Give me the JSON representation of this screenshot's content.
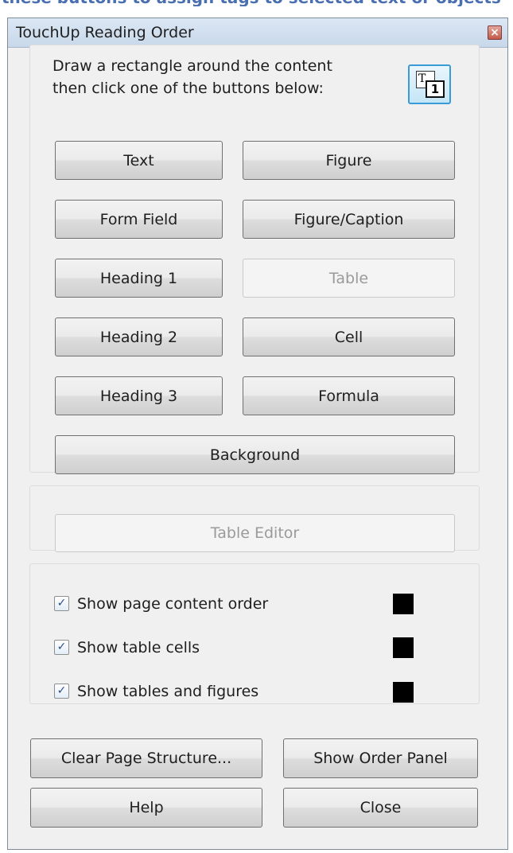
{
  "background": {
    "caption": "these buttons to assign tags to selected text or objects"
  },
  "window": {
    "title": "TouchUp Reading Order",
    "close_glyph": "×"
  },
  "instructions": {
    "line1": "Draw a rectangle around the content",
    "line2": "then click one of the buttons below:"
  },
  "tag_icon": {
    "name": "show-tag-icon",
    "glyph_t": "T",
    "glyph_1": "1"
  },
  "tag_buttons": {
    "text": "Text",
    "figure": "Figure",
    "form_field": "Form Field",
    "figure_caption": "Figure/Caption",
    "heading1": "Heading 1",
    "table": "Table",
    "heading2": "Heading 2",
    "cell": "Cell",
    "heading3": "Heading 3",
    "formula": "Formula",
    "background": "Background"
  },
  "table_editor": {
    "label": "Table Editor",
    "enabled": false
  },
  "options": [
    {
      "label": "Show page content order",
      "checked": true,
      "color": "#000000"
    },
    {
      "label": "Show table cells",
      "checked": true,
      "color": "#000000"
    },
    {
      "label": "Show tables and figures",
      "checked": true,
      "color": "#000000"
    }
  ],
  "check_glyph": "✓",
  "bottom_buttons": {
    "clear": "Clear Page Structure...",
    "show_order": "Show Order Panel",
    "help": "Help",
    "close": "Close"
  }
}
